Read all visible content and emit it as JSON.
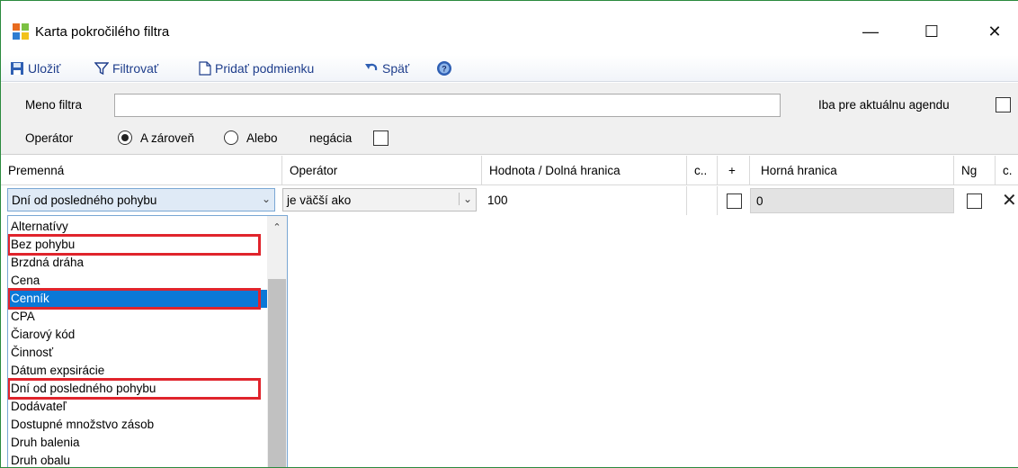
{
  "window": {
    "title": "Karta pokročilého filtra",
    "controls": {
      "minimize": "—",
      "maximize": "☐",
      "close": "✕"
    }
  },
  "toolbar": {
    "save": "Uložiť",
    "filter": "Filtrovať",
    "add_condition": "Pridať podmienku",
    "back": "Späť"
  },
  "panel": {
    "name_label": "Meno filtra",
    "name_value": "",
    "only_current_label": "Iba pre aktuálnu agendu",
    "operator_label": "Operátor",
    "option_and": "A zároveň",
    "option_or": "Alebo",
    "negation_label": "negácia",
    "selected_operator": "A zároveň"
  },
  "grid": {
    "columns": [
      "Premenná",
      "Operátor",
      "Hodnota / Dolná hranica",
      "c..",
      "+",
      "Horná hranica",
      "Ng",
      "c."
    ],
    "row": {
      "variable": "Dní od posledného pohybu",
      "operator": "je väčší ako",
      "lower": "100",
      "upper": "0"
    }
  },
  "dropdown": {
    "items": [
      "Alternatívy",
      "Bez pohybu",
      "Brzdná dráha",
      "Cena",
      "Cenník",
      "CPA",
      "Čiarový kód",
      "Činnosť",
      "Dátum expsirácie",
      "Dní od posledného pohybu",
      "Dodávateľ",
      "Dostupné množstvo zásob",
      "Druh balenia",
      "Druh obalu"
    ],
    "selected": "Cenník",
    "highlighted": [
      "Bez pohybu",
      "Cenník",
      "Dní od posledného pohybu"
    ]
  },
  "colors": {
    "toolbar_text": "#1f3e8c",
    "selection": "#0a78d7",
    "highlight_box": "#e0242c"
  }
}
